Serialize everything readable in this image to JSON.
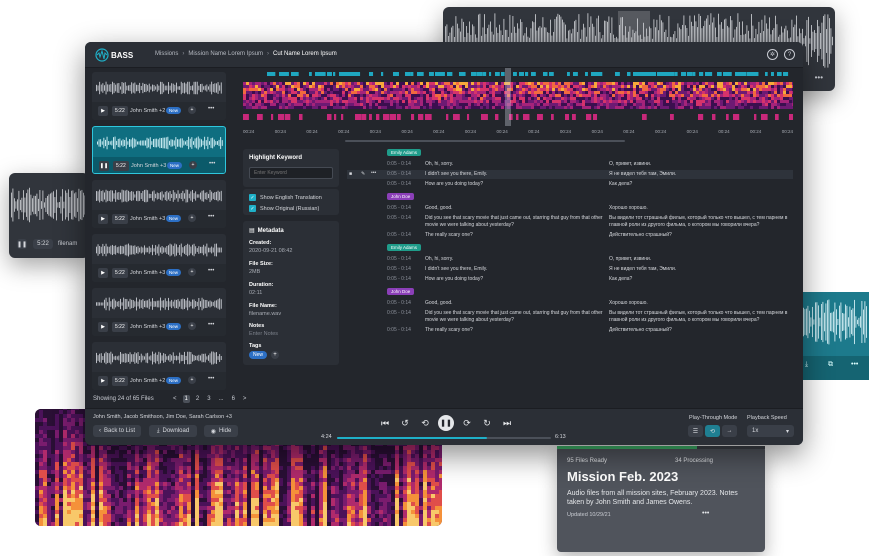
{
  "app": {
    "logo": "BASS",
    "breadcrumb": [
      "Missions",
      "Mission Name Lorem Ipsum",
      "Cut Name Lorem Ipsum"
    ]
  },
  "left_card": {
    "duration": "5:22",
    "filename": "filenam"
  },
  "right_card": {
    "menu": "•••"
  },
  "top_card": {
    "menu": "•••"
  },
  "file_list": {
    "items": [
      {
        "duration": "5:22",
        "speakers": "John Smith +2",
        "badge": "New"
      },
      {
        "duration": "5:22",
        "speakers": "John Smith +3",
        "badge": "New"
      },
      {
        "duration": "5:22",
        "speakers": "John Smith +3",
        "badge": "New"
      },
      {
        "duration": "5:22",
        "speakers": "John Smith +3",
        "badge": "New"
      },
      {
        "duration": "5:22",
        "speakers": "John Smith +3",
        "badge": "New"
      },
      {
        "duration": "5:22",
        "speakers": "John Smith +2",
        "badge": "New"
      }
    ],
    "showing": "Showing 24 of 65 Files",
    "pages": [
      "<",
      "1",
      "2",
      "3",
      "...",
      "6",
      ">"
    ]
  },
  "timeline": {
    "ticks": [
      "00:24",
      "00:24",
      "00:24",
      "00:24",
      "00:24",
      "00:24",
      "00:24",
      "00:24",
      "00:24",
      "00:24",
      "00:24",
      "00:24",
      "00:24",
      "00:24",
      "00:24",
      "00:24",
      "00:24",
      "00:24"
    ]
  },
  "controls": {
    "highlight_label": "Highlight Keyword",
    "keyword_placeholder": "Enter Keyword",
    "show_english": "Show English Translation",
    "show_original": "Show Original (Russian)"
  },
  "metadata": {
    "title": "Metadata",
    "created_label": "Created:",
    "created": "2020-09-21 08:42",
    "size_label": "File Size:",
    "size": "2MB",
    "duration_label": "Duration:",
    "duration": "02:11",
    "name_label": "File Name:",
    "name": "filename.wav",
    "notes_label": "Notes",
    "notes": "Enter Notes",
    "tags_label": "Tags",
    "tag": "New"
  },
  "transcript": [
    {
      "speaker": "Emily Adams",
      "speaker_color": "#1f9c8a",
      "lines": [
        {
          "time": "0:05 - 0:14",
          "en": "Oh, hi, sorry.",
          "ru": "О, привет, извини."
        },
        {
          "time": "0:05 - 0:14",
          "en": "I didn't see you there, Emily.",
          "ru": "Я не видел тебя там, Эмили."
        },
        {
          "time": "0:05 - 0:14",
          "en": "How are you doing today?",
          "ru": "Как дела?"
        }
      ]
    },
    {
      "speaker": "John Doe",
      "speaker_color": "#8b3fb8",
      "lines": [
        {
          "time": "0:05 - 0:14",
          "en": "Good, good.",
          "ru": "Хорошо хорошо."
        },
        {
          "time": "0:05 - 0:14",
          "en": "Did you see that scary movie that just came out, starring that guy from that other movie we were talking about yesterday?",
          "ru": "Вы видели тот страшный фильм, который только что вышел, с тем парнем в главной роли из другого фильма, о котором мы говорили вчера?"
        },
        {
          "time": "0:05 - 0:14",
          "en": "The really scary one?",
          "ru": "Действительно страшный?"
        }
      ]
    },
    {
      "speaker": "Emily Adams",
      "speaker_color": "#1f9c8a",
      "lines": [
        {
          "time": "0:05 - 0:14",
          "en": "Oh, hi, sorry.",
          "ru": "О, привет, извини."
        },
        {
          "time": "0:05 - 0:14",
          "en": "I didn't see you there, Emily.",
          "ru": "Я не видел тебя там, Эмили."
        },
        {
          "time": "0:05 - 0:14",
          "en": "How are you doing today?",
          "ru": "Как дела?"
        }
      ]
    },
    {
      "speaker": "John Doe",
      "speaker_color": "#8b3fb8",
      "lines": [
        {
          "time": "0:05 - 0:14",
          "en": "Good, good.",
          "ru": "Хорошо хорошо."
        },
        {
          "time": "0:05 - 0:14",
          "en": "Did you see that scary movie that just came out, starring that guy from that other movie we were talking about yesterday?",
          "ru": "Вы видели тот страшный фильм, который только что вышел, с тем парнем в главной роли из другого фильма, о котором мы говорили вчера?"
        },
        {
          "time": "0:05 - 0:14",
          "en": "The really scary one?",
          "ru": "Действительно страшный?"
        }
      ]
    }
  ],
  "player": {
    "speakers": "John Smith, Jacob Smithson, Jim Doe, Sarah Carlson +3",
    "back": "Back to List",
    "download": "Download",
    "hide": "Hide",
    "elapsed": "4:24",
    "total": "6:13",
    "progress": 0.7,
    "playthrough_label": "Play-Through Mode",
    "speed_label": "Playback Speed",
    "speed": "1x"
  },
  "mission": {
    "ready": "95 Files Ready",
    "processing": "34 Processing",
    "title": "Mission Feb. 2023",
    "desc": "Audio files from all mission sites, February 2023. Notes taken by John Smith and James Owens.",
    "updated": "Updated 10/29/21",
    "menu": "•••"
  },
  "colors": {
    "accent": "#1fb0c8",
    "bg": "#23262c",
    "panel": "#2b2f36",
    "teal_sel": "#0f6e80"
  }
}
